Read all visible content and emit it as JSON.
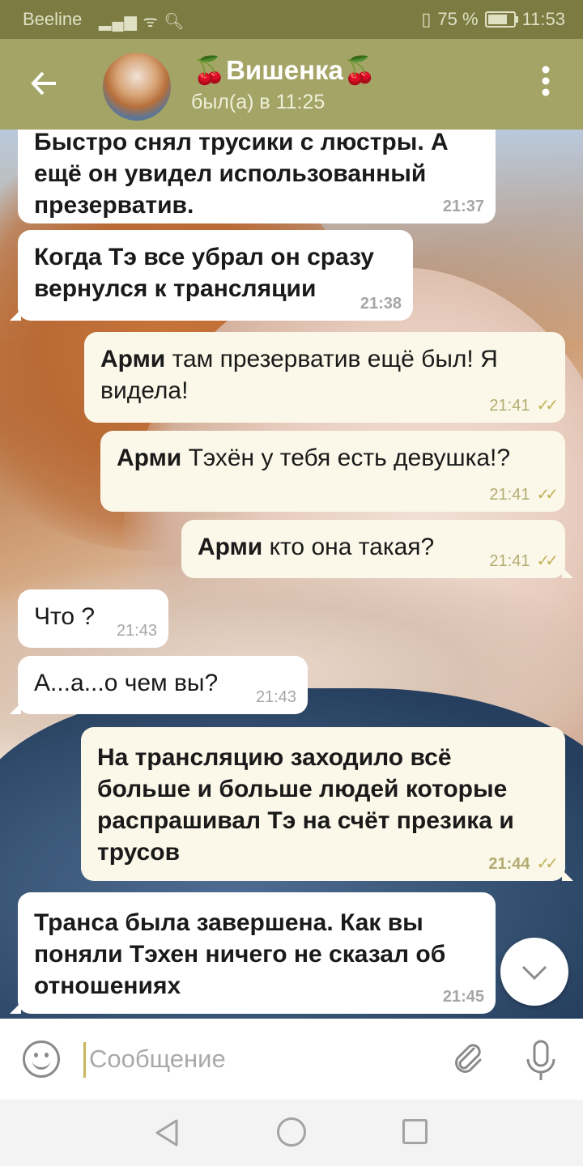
{
  "status_bar": {
    "carrier": "Beeline",
    "signal": "⁴ᴳ",
    "vibrate_icon": "vibrate-icon",
    "battery_pct": "75 %",
    "battery_level": 0.75,
    "time": "11:53"
  },
  "header": {
    "title": "🍒Вишенка🍒",
    "status": "был(а) в 11:25"
  },
  "messages": [
    {
      "direction": "in",
      "text": "Быстро снял трусики с люстры. А ещё он увидел использованный презерватив.",
      "time": "21:37"
    },
    {
      "direction": "in",
      "text": "Когда Тэ все убрал он сразу вернулся к трансляции",
      "time": "21:38"
    },
    {
      "direction": "out",
      "author": "Арми",
      "text": " там презерватив ещё был! Я видела!",
      "time": "21:41",
      "read": true
    },
    {
      "direction": "out",
      "author": "Арми",
      "text": " Тэхён у тебя есть девушка!?",
      "time": "21:41",
      "read": true
    },
    {
      "direction": "out",
      "author": "Арми",
      "text": " кто она такая?",
      "time": "21:41",
      "read": true
    },
    {
      "direction": "in",
      "text": "Что ?",
      "time": "21:43"
    },
    {
      "direction": "in",
      "text": "А...а...о чем вы?",
      "time": "21:43"
    },
    {
      "direction": "out",
      "text": "На трансляцию заходило всё больше и больше людей которые распрашивал Тэ на счёт презика и трусов",
      "time": "21:44",
      "read": true
    },
    {
      "direction": "in",
      "text": "Транса была завершена. Как вы поняли Тэхен ничего не сказал об отношениях",
      "time": "21:45"
    }
  ],
  "input": {
    "placeholder": "Сообщение",
    "value": ""
  },
  "icons": {
    "back": "arrow-left-icon",
    "more": "more-vertical-icon",
    "emoji": "emoji-icon",
    "attach": "paperclip-icon",
    "mic": "microphone-icon",
    "scroll": "chevron-down-icon",
    "ticks": "double-check-icon"
  },
  "colors": {
    "header": "#a4a466",
    "status_bar": "#7b7b42",
    "outgoing_bubble": "#fbf8e9",
    "incoming_bubble": "#ffffff",
    "read_ticks": "#c2b25a"
  }
}
